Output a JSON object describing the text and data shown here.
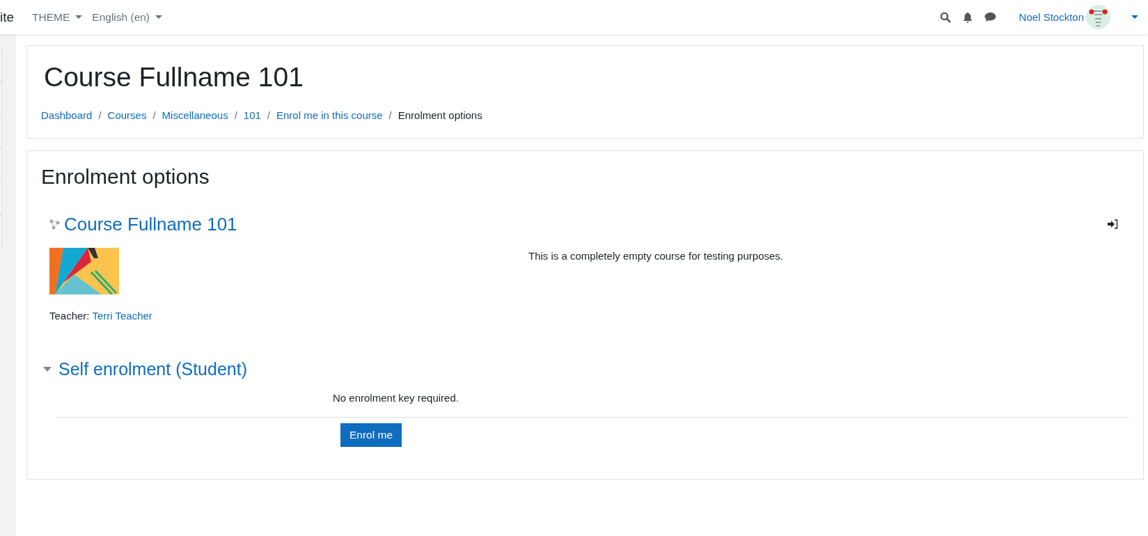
{
  "navbar": {
    "site_name": "ite",
    "menus": [
      {
        "label": "THEME"
      },
      {
        "label": "English (en)"
      }
    ],
    "user_name": "Noel Stockton"
  },
  "header": {
    "title": "Course Fullname 101",
    "breadcrumb": [
      {
        "label": "Dashboard",
        "link": true
      },
      {
        "separator": "/",
        "label": "Courses",
        "link": true
      },
      {
        "separator": "/",
        "label": "Miscellaneous",
        "link": true
      },
      {
        "separator": "/",
        "label": "101",
        "link": true
      },
      {
        "separator": "/",
        "label": "Enrol me in this course",
        "link": true
      },
      {
        "separator": "/",
        "label": "Enrolment options",
        "link": false
      }
    ]
  },
  "enrolment": {
    "heading": "Enrolment options",
    "course": {
      "name": "Course Fullname 101",
      "description": "This is a completely empty course for testing purposes.",
      "teacher_label": "Teacher:",
      "teacher_name": "Terri Teacher"
    },
    "methods": [
      {
        "title": "Self enrolment (Student)",
        "expanded": true,
        "note": "No enrolment key required.",
        "button": "Enrol me"
      }
    ]
  }
}
